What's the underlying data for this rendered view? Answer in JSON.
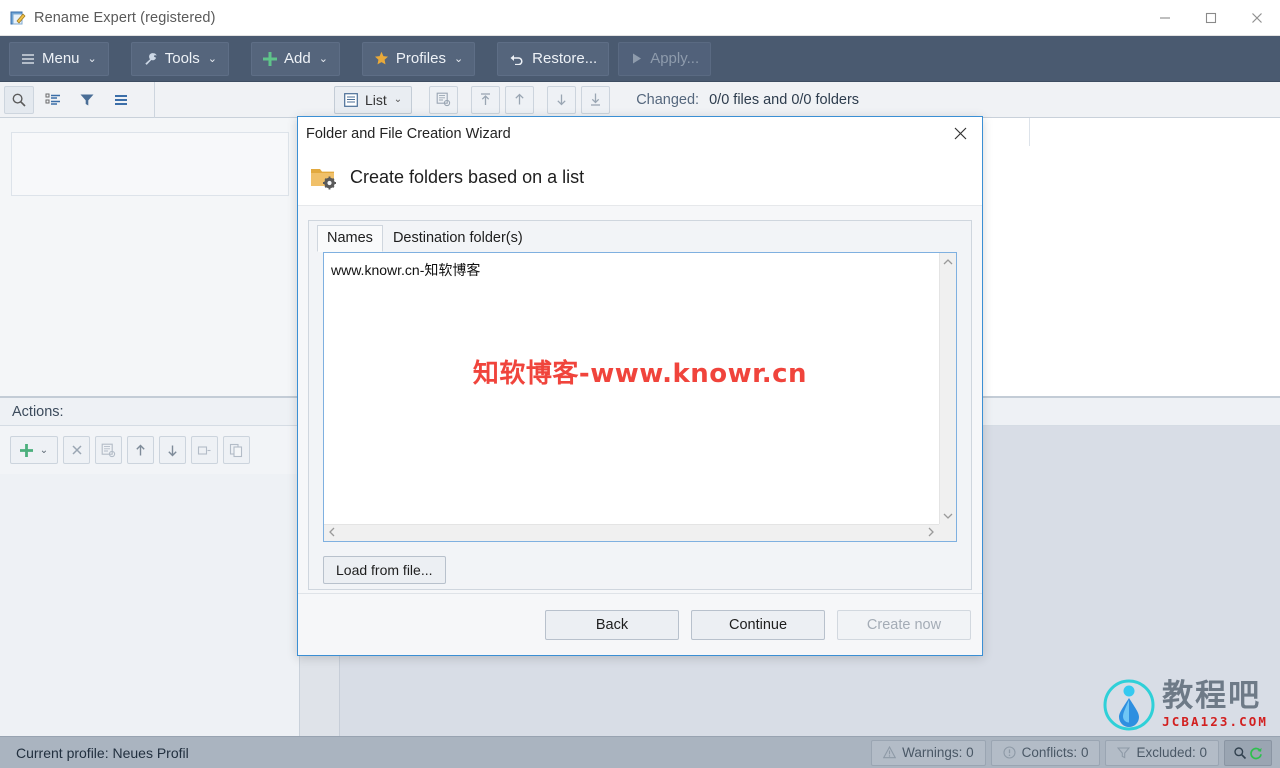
{
  "window": {
    "title": "Rename Expert (registered)",
    "app_icon": "app-icon",
    "minimize": "–",
    "maximize": "□",
    "close": "✕"
  },
  "toolbar": {
    "buttons": [
      {
        "label": "Menu",
        "icon": "hamburger-icon",
        "caret": "⌄",
        "disabled": false
      },
      {
        "label": "Tools",
        "icon": "wrench-icon",
        "caret": "⌄",
        "disabled": false
      },
      {
        "label": "Add",
        "icon": "plus-icon",
        "caret": "⌄",
        "disabled": false
      },
      {
        "label": "Profiles",
        "icon": "star-icon",
        "caret": "⌄",
        "disabled": false
      },
      {
        "label": "Restore...",
        "icon": "undo-icon",
        "caret": "",
        "disabled": false
      },
      {
        "label": "Apply...",
        "icon": "play-icon",
        "caret": "",
        "disabled": true
      }
    ],
    "accent_dark": "#4a5a70",
    "accent_plus": "#5fc48a",
    "accent_star": "#e8a93a"
  },
  "subbar": {
    "left_icons": [
      {
        "name": "search-icon",
        "active": true
      },
      {
        "name": "tree-list-icon",
        "active": false
      },
      {
        "name": "filter-icon",
        "active": false
      },
      {
        "name": "list-lines-icon",
        "active": false
      }
    ],
    "view_button": {
      "label": "List",
      "icon": "list-view-icon",
      "caret": "⌄"
    },
    "nav_icons": [
      "settings-list-icon",
      "move-to-top-icon",
      "move-up-icon",
      "move-down-icon",
      "move-to-bottom-icon"
    ],
    "changed_label": "Changed:",
    "changed_value": "0/0 files and 0/0 folders"
  },
  "left_panel": {
    "actions_label": "Actions:",
    "action_buttons": [
      {
        "name": "add-action-button",
        "glyph": "✚",
        "caret": "⌄"
      },
      {
        "name": "remove-action-button",
        "glyph": "✕"
      },
      {
        "name": "edit-action-button",
        "glyph": "▤"
      },
      {
        "name": "move-action-up-button",
        "glyph": "↑"
      },
      {
        "name": "move-action-down-button",
        "glyph": "↓"
      },
      {
        "name": "rename-action-button",
        "glyph": "▭"
      },
      {
        "name": "copy-action-button",
        "glyph": "❐"
      }
    ]
  },
  "dialog": {
    "title": "Folder and File Creation Wizard",
    "close_glyph": "✕",
    "heading": "Create folders based on a list",
    "heading_icon": "folder-settings-icon",
    "tabs": [
      {
        "label": "Names",
        "active": true
      },
      {
        "label": "Destination folder(s)",
        "active": false
      }
    ],
    "editor": {
      "value": "www.knowr.cn-知软博客",
      "watermark": "知软博客-www.knowr.cn",
      "watermark_color": "#f0443c",
      "scroll_up": "⌃",
      "scroll_down": "⌄",
      "scroll_left": "‹",
      "scroll_right": "›"
    },
    "load_button": "Load from file...",
    "footer_buttons": [
      {
        "label": "Back",
        "disabled": false
      },
      {
        "label": "Continue",
        "disabled": false
      },
      {
        "label": "Create now",
        "disabled": true
      }
    ]
  },
  "statusbar": {
    "profile": "Current profile: Neues Profil",
    "indicators": [
      {
        "label": "Warnings: 0",
        "icon": "warning-icon"
      },
      {
        "label": "Conflicts: 0",
        "icon": "conflict-icon"
      },
      {
        "label": "Excluded: 0",
        "icon": "filter-icon"
      }
    ],
    "refresh_button": {
      "name": "search-refresh-button",
      "glyph": "🔍"
    }
  },
  "brand": {
    "name": "教程吧",
    "domain": "JCBA123.COM",
    "icon": "water-drop-logo"
  }
}
